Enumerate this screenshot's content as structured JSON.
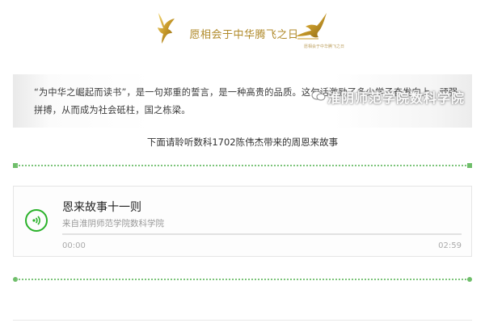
{
  "header": {
    "title": "愿相会于中华腾飞之日",
    "ghost": "愿相会于中华腾飞之日"
  },
  "intro": {
    "text": "“为中华之崛起而读书”，是一句郑重的誓言，是一种高贵的品质。这句话激励了多少学子奋发向上，顽强拼搏，从而成为社会砥柱，国之栋梁。"
  },
  "watermark": {
    "text": "淮阴师范学院数科学院",
    "icon": "wechat-icon"
  },
  "subtitle": "下面请聆听数科1702陈伟杰带来的周恩来故事",
  "audio": {
    "title": "恩来故事十一则",
    "source": "来自淮阴师范学院数科学院",
    "current_time": "00:00",
    "total_time": "02:59",
    "progress": 0,
    "icon": "sound-wave-icon"
  },
  "colors": {
    "accent_green": "#2bb22b",
    "divider_green": "#7cc47a",
    "gold": "#b08a2a"
  }
}
